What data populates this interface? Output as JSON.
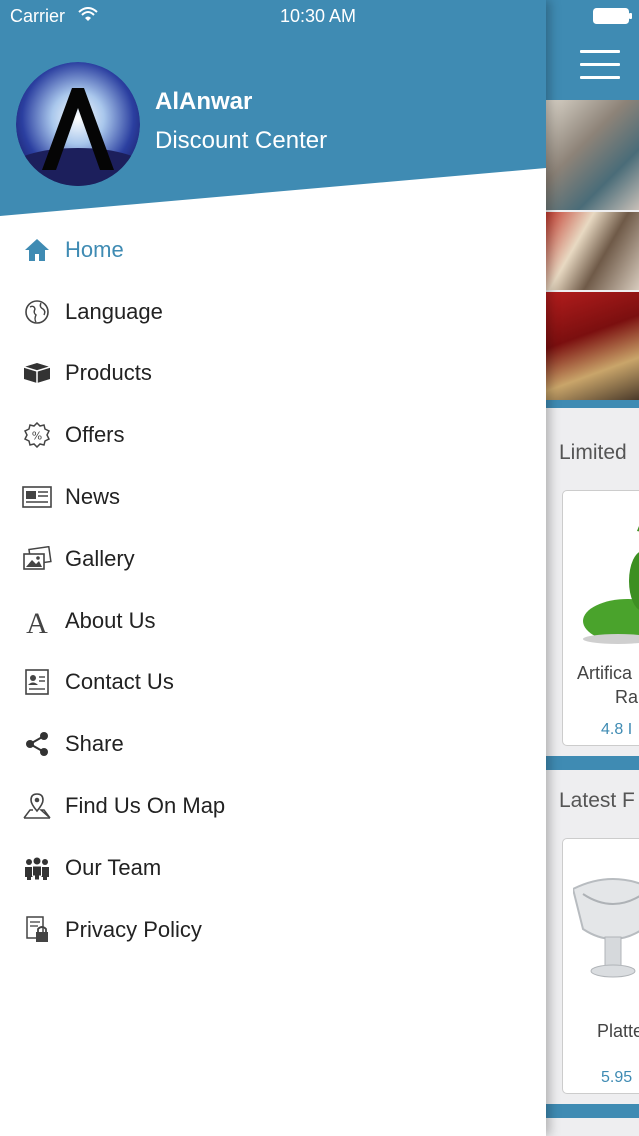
{
  "status_bar": {
    "carrier": "Carrier",
    "time": "10:30 AM"
  },
  "brand": {
    "name": "AlAnwar",
    "subtitle": "Discount Center"
  },
  "colors": {
    "accent": "#3f8bb3",
    "text": "#222222"
  },
  "menu": [
    {
      "label": "Home",
      "icon": "home-icon",
      "active": true
    },
    {
      "label": "Language",
      "icon": "globe-icon"
    },
    {
      "label": "Products",
      "icon": "box-icon"
    },
    {
      "label": "Offers",
      "icon": "percent-badge-icon"
    },
    {
      "label": "News",
      "icon": "newspaper-icon"
    },
    {
      "label": "Gallery",
      "icon": "gallery-icon"
    },
    {
      "label": "About Us",
      "icon": "letter-a-icon"
    },
    {
      "label": "Contact Us",
      "icon": "contact-card-icon"
    },
    {
      "label": "Share",
      "icon": "share-icon"
    },
    {
      "label": "Find Us On Map",
      "icon": "map-pin-icon"
    },
    {
      "label": "Our Team",
      "icon": "team-icon"
    },
    {
      "label": "Privacy Policy",
      "icon": "privacy-lock-icon"
    }
  ],
  "main": {
    "section_limited": "Limited",
    "product1": {
      "name_line1": "Artifica",
      "name_line2": "Ra",
      "price": "4.8 I"
    },
    "section_latest": "Latest F",
    "product2": {
      "name": "Platte",
      "price": "5.95"
    }
  }
}
